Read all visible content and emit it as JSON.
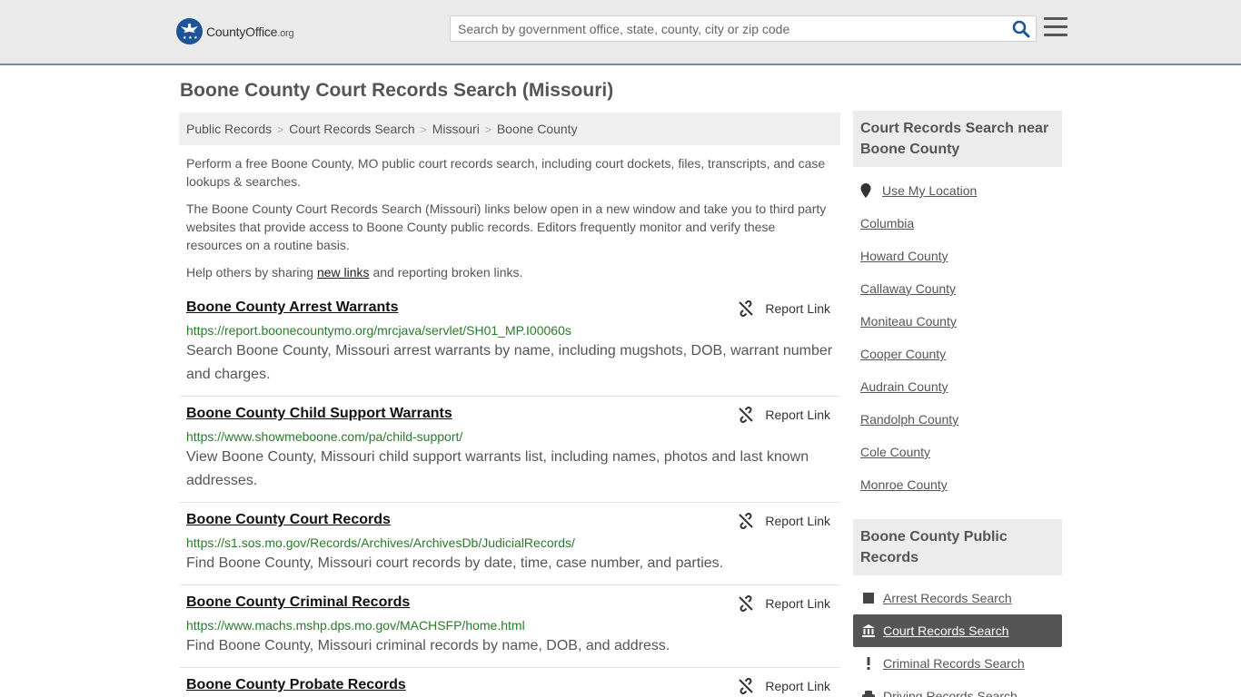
{
  "header": {
    "logo_name": "CountyOffice",
    "logo_tld": ".org",
    "search_placeholder": "Search by government office, state, county, city or zip code"
  },
  "page": {
    "title": "Boone County Court Records Search (Missouri)"
  },
  "breadcrumb": [
    "Public Records",
    "Court Records Search",
    "Missouri",
    "Boone County"
  ],
  "intro": {
    "p1": "Perform a free Boone County, MO public court records search, including court dockets, files, transcripts, and case lookups & searches.",
    "p2": "The Boone County Court Records Search (Missouri) links below open in a new window and take you to third party websites that provide access to Boone County public records. Editors frequently monitor and verify these resources on a routine basis.",
    "p3_before": "Help others by sharing ",
    "p3_link": "new links",
    "p3_after": " and reporting broken links."
  },
  "report_label": "Report Link",
  "records": [
    {
      "title": "Boone County Arrest Warrants",
      "url": "https://report.boonecountymo.org/mrcjava/servlet/SH01_MP.I00060s",
      "desc": "Search Boone County, Missouri arrest warrants by name, including mugshots, DOB, warrant number and charges."
    },
    {
      "title": "Boone County Child Support Warrants",
      "url": "https://www.showmeboone.com/pa/child-support/",
      "desc": "View Boone County, Missouri child support warrants list, including names, photos and last known addresses."
    },
    {
      "title": "Boone County Court Records",
      "url": "https://s1.sos.mo.gov/Records/Archives/ArchivesDb/JudicialRecords/",
      "desc": "Find Boone County, Missouri court records by date, time, case number, and parties."
    },
    {
      "title": "Boone County Criminal Records",
      "url": "https://www.machs.mshp.dps.mo.gov/MACHSFP/home.html",
      "desc": "Find Boone County, Missouri criminal records by name, DOB, and address."
    },
    {
      "title": "Boone County Probate Records",
      "url": "",
      "desc": ""
    }
  ],
  "sidebar": {
    "near_heading": "Court Records Search near Boone County",
    "use_location": "Use My Location",
    "near_links": [
      "Columbia",
      "Howard County",
      "Callaway County",
      "Moniteau County",
      "Cooper County",
      "Audrain County",
      "Randolph County",
      "Cole County",
      "Monroe County"
    ],
    "public_heading": "Boone County Public Records",
    "public_links": [
      "Arrest Records Search",
      "Court Records Search",
      "Criminal Records Search",
      "Driving Records Search"
    ]
  }
}
